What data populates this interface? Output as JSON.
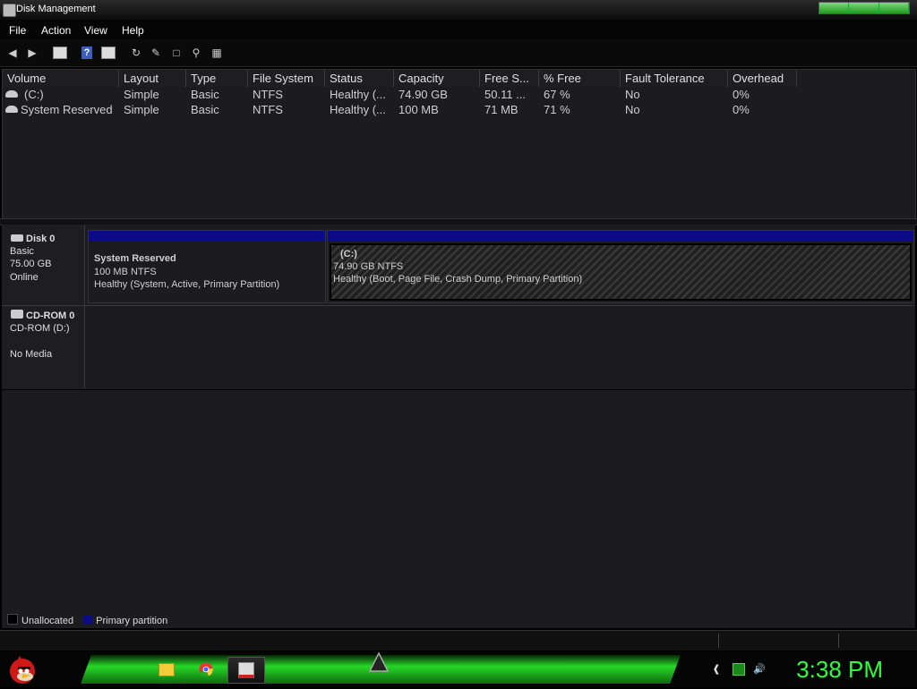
{
  "window": {
    "title": "Disk Management"
  },
  "menu": [
    "File",
    "Action",
    "View",
    "Help"
  ],
  "volume_list": {
    "columns": [
      "Volume",
      "Layout",
      "Type",
      "File System",
      "Status",
      "Capacity",
      "Free S...",
      "% Free",
      "Fault Tolerance",
      "Overhead"
    ],
    "rows": [
      [
        "(C:)",
        "Simple",
        "Basic",
        "NTFS",
        "Healthy (...",
        "74.90 GB",
        "50.11 ...",
        "67 %",
        "No",
        "0%"
      ],
      [
        "System Reserved",
        "Simple",
        "Basic",
        "NTFS",
        "Healthy (...",
        "100 MB",
        "71 MB",
        "71 %",
        "No",
        "0%"
      ]
    ]
  },
  "disk0": {
    "name": "Disk 0",
    "type": "Basic",
    "size": "75.00 GB",
    "state": "Online",
    "partitions": [
      {
        "name": "System Reserved",
        "size": "100 MB NTFS",
        "status": "Healthy (System, Active, Primary Partition)"
      },
      {
        "name": "(C:)",
        "size": "74.90 GB NTFS",
        "status": "Healthy (Boot, Page File, Crash Dump, Primary Partition)"
      }
    ]
  },
  "cdrom0": {
    "name": "CD-ROM 0",
    "drive": "CD-ROM (D:)",
    "media": "No Media"
  },
  "legend": {
    "unallocated": {
      "label": "Unallocated",
      "color": "#000000"
    },
    "primary": {
      "label": "Primary partition",
      "color": "#0b0b8a"
    }
  },
  "taskbar": {
    "clock": "3:38 PM",
    "accent_color": "#2aff3a"
  }
}
